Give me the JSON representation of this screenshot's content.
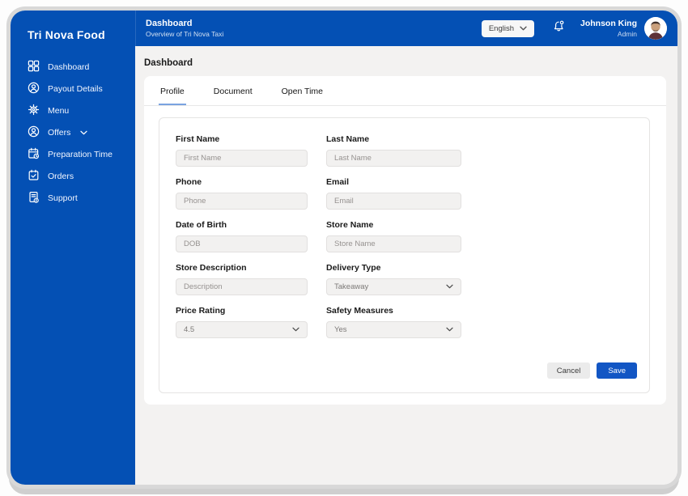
{
  "app": {
    "brand": "Tri Nova Food"
  },
  "colors": {
    "primary_blue": "#0450b4",
    "save_blue": "#1256c4",
    "tab_underline": "#7aa3e0",
    "main_bg": "#f3f2f1"
  },
  "sidebar": {
    "items": [
      {
        "label": "Dashboard",
        "icon": "dashboard-grid-icon"
      },
      {
        "label": "Payout Details",
        "icon": "user-circle-icon"
      },
      {
        "label": "Menu",
        "icon": "gear-icon"
      },
      {
        "label": "Offers",
        "icon": "user-circle-icon",
        "chevron": "true"
      },
      {
        "label": "Preparation Time",
        "icon": "calendar-clock-icon"
      },
      {
        "label": "Orders",
        "icon": "calendar-check-icon"
      },
      {
        "label": "Support",
        "icon": "document-badge-icon"
      }
    ]
  },
  "header": {
    "title": "Dashboard",
    "subtitle": "Overview of Tri Nova Taxi",
    "language": "English",
    "user": {
      "name": "Johnson King",
      "role": "Admin"
    }
  },
  "main": {
    "heading": "Dashboard",
    "tabs": [
      {
        "label": "Profile"
      },
      {
        "label": "Document"
      },
      {
        "label": "Open Time"
      }
    ],
    "form": {
      "fields": [
        {
          "label": "First Name",
          "placeholder": "First Name",
          "type": "text"
        },
        {
          "label": "Last Name",
          "placeholder": "Last Name",
          "type": "text"
        },
        {
          "label": "Phone",
          "placeholder": "Phone",
          "type": "text"
        },
        {
          "label": "Email",
          "placeholder": "Email",
          "type": "text"
        },
        {
          "label": "Date of Birth",
          "placeholder": "DOB",
          "type": "text"
        },
        {
          "label": "Store Name",
          "placeholder": "Store Name",
          "type": "text"
        },
        {
          "label": "Store Description",
          "placeholder": "Description",
          "type": "text"
        },
        {
          "label": "Delivery Type",
          "value": "Takeaway",
          "type": "select"
        },
        {
          "label": "Price Rating",
          "value": "4.5",
          "type": "select"
        },
        {
          "label": "Safety Measures",
          "value": "Yes",
          "type": "select"
        }
      ],
      "buttons": {
        "cancel": "Cancel",
        "save": "Save"
      }
    }
  }
}
